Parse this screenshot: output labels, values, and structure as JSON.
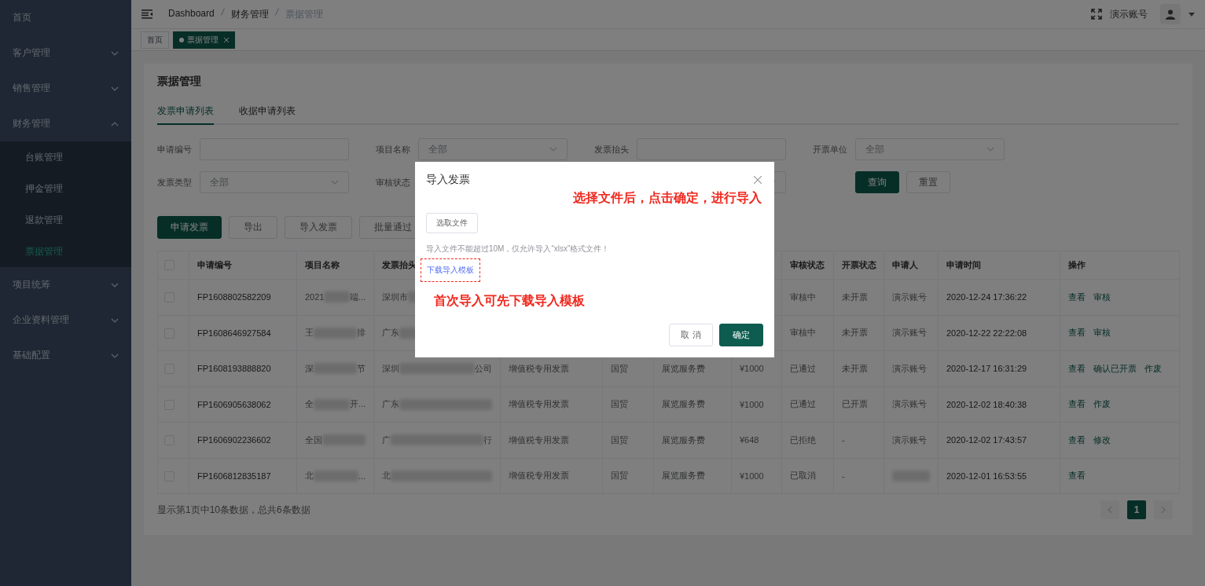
{
  "sidebar": {
    "items": [
      {
        "label": "首页"
      },
      {
        "label": "客户管理",
        "expanded": false
      },
      {
        "label": "销售管理",
        "expanded": false
      },
      {
        "label": "财务管理",
        "expanded": true,
        "children": [
          {
            "label": "台账管理",
            "selected": false
          },
          {
            "label": "押金管理",
            "selected": false
          },
          {
            "label": "退款管理",
            "selected": false
          },
          {
            "label": "票据管理",
            "selected": true
          }
        ]
      },
      {
        "label": "项目统筹",
        "expanded": false
      },
      {
        "label": "企业资料管理",
        "expanded": false
      },
      {
        "label": "基础配置",
        "expanded": false
      }
    ]
  },
  "header": {
    "breadcrumb": [
      "Dashboard",
      "财务管理",
      "票据管理"
    ],
    "user": "演示账号"
  },
  "tags": [
    {
      "label": "首页",
      "selected": false
    },
    {
      "label": "票据管理",
      "selected": true,
      "closable": true
    }
  ],
  "page_title": "票据管理",
  "tabs": [
    {
      "label": "发票申请列表",
      "selected": true
    },
    {
      "label": "收据申请列表",
      "selected": false
    }
  ],
  "filters": [
    {
      "label": "申请编号",
      "kind": "input"
    },
    {
      "label": "项目名称",
      "kind": "select",
      "placeholder": "全部"
    },
    {
      "label": "发票抬头",
      "kind": "input"
    },
    {
      "label": "开票单位",
      "kind": "select",
      "placeholder": "全部"
    },
    {
      "label": "发票类型",
      "kind": "select",
      "placeholder": "全部"
    },
    {
      "label": "审核状态"
    },
    {
      "kind": "select"
    }
  ],
  "filter_buttons": [
    {
      "label": "查询",
      "primary": true
    },
    {
      "label": "重置",
      "primary": false
    }
  ],
  "actions": [
    {
      "label": "申请发票",
      "primary": true
    },
    {
      "label": "导出",
      "primary": false
    },
    {
      "label": "导入发票",
      "primary": false
    },
    {
      "label": "批量通过",
      "primary": false
    }
  ],
  "table": {
    "all_checked": false,
    "columns": [
      "申请编号",
      "项目名称",
      "发票抬头",
      null,
      null,
      null,
      null,
      "审核状态",
      "开票状态",
      "申请人",
      "申请时间",
      "操作"
    ],
    "rows": [
      {
        "checked": false,
        "number": "FP1608802582209",
        "project": {
          "head": "2021",
          "tail": "端...",
          "redacted": true
        },
        "title": {
          "head": "深圳市",
          "redacted": true
        },
        "audit": "审核中",
        "invoice": "未开票",
        "applicant": {
          "head": "演示账号"
        },
        "time": "2020-12-24 17:36:22",
        "ops": [
          "查看",
          "审核"
        ]
      },
      {
        "checked": false,
        "number": "FP1608646927584",
        "project": {
          "head": "王",
          "tail": "排",
          "redacted": true
        },
        "title": {
          "head": "广东",
          "redacted": true
        },
        "audit": "审核中",
        "invoice": "未开票",
        "applicant": {
          "head": "演示账号"
        },
        "time": "2020-12-22 22:22:08",
        "ops": [
          "查看",
          "审核"
        ]
      },
      {
        "checked": false,
        "number": "FP1608193888820",
        "project": {
          "head": "深",
          "tail": "节",
          "redacted": true
        },
        "title": {
          "head": "深圳",
          "tail": "公司",
          "redacted": true
        },
        "type": "增值税专用发票",
        "trade": "国贸",
        "service": "展览服务费",
        "amount": "¥1000",
        "audit": "已通过",
        "invoice": "未开票",
        "applicant": {
          "head": "演示账号"
        },
        "time": "2020-12-17 16:31:29",
        "ops": [
          "查看",
          "确认已开票",
          "作废"
        ]
      },
      {
        "checked": false,
        "number": "FP1606905638062",
        "project": {
          "head": "全",
          "tail": "开...",
          "redacted": true
        },
        "title": {
          "head": "广东",
          "redacted": true
        },
        "type": "增值税专用发票",
        "trade": "国贸",
        "service": "展览服务费",
        "amount": "¥1000",
        "audit": "已通过",
        "invoice": "已开票",
        "applicant": {
          "head": "演示账号"
        },
        "time": "2020-12-02 18:40:38",
        "ops": [
          "查看",
          "作废"
        ]
      },
      {
        "checked": false,
        "number": "FP1606902236602",
        "project": {
          "head": "全国",
          "redacted": true
        },
        "title": {
          "head": "广",
          "tail": "行",
          "redacted": true
        },
        "type": "增值税专用发票",
        "trade": "国贸",
        "service": "展览服务费",
        "amount": "¥648",
        "audit": "已拒绝",
        "invoice": "-",
        "applicant": {
          "head": "演示账号"
        },
        "time": "2020-12-02 17:43:57",
        "ops": [
          "查看",
          "修改"
        ]
      },
      {
        "checked": false,
        "number": "FP1606812835187",
        "project": {
          "head": "北",
          "tail": "...",
          "redacted": true
        },
        "title": {
          "head": "北",
          "redacted": true
        },
        "type": "增值税专用发票",
        "trade": "国贸",
        "service": "展览服务费",
        "amount": "¥1000",
        "audit": "已取消",
        "invoice": "-",
        "applicant": {
          "redacted": true
        },
        "time": "2020-12-01 16:53:55",
        "ops": [
          "查看"
        ]
      }
    ]
  },
  "footer_text": "显示第1页中10条数据，总共6条数据",
  "pagination": {
    "pages": [
      {
        "label": "1",
        "selected": true
      }
    ]
  },
  "modal": {
    "title": "导入发票",
    "callouts": [
      "选择文件后，点击确定，进行导入",
      "首次导入可先下载导入模板"
    ],
    "file_button": "选取文件",
    "hint": "导入文件不能超过10M，仅允许导入“xlsx”格式文件！",
    "template_link": {
      "label": "下载导入模板",
      "highlighted": true
    },
    "buttons": [
      {
        "label": "取 消",
        "primary": false
      },
      {
        "label": "确定",
        "primary": true
      }
    ]
  }
}
